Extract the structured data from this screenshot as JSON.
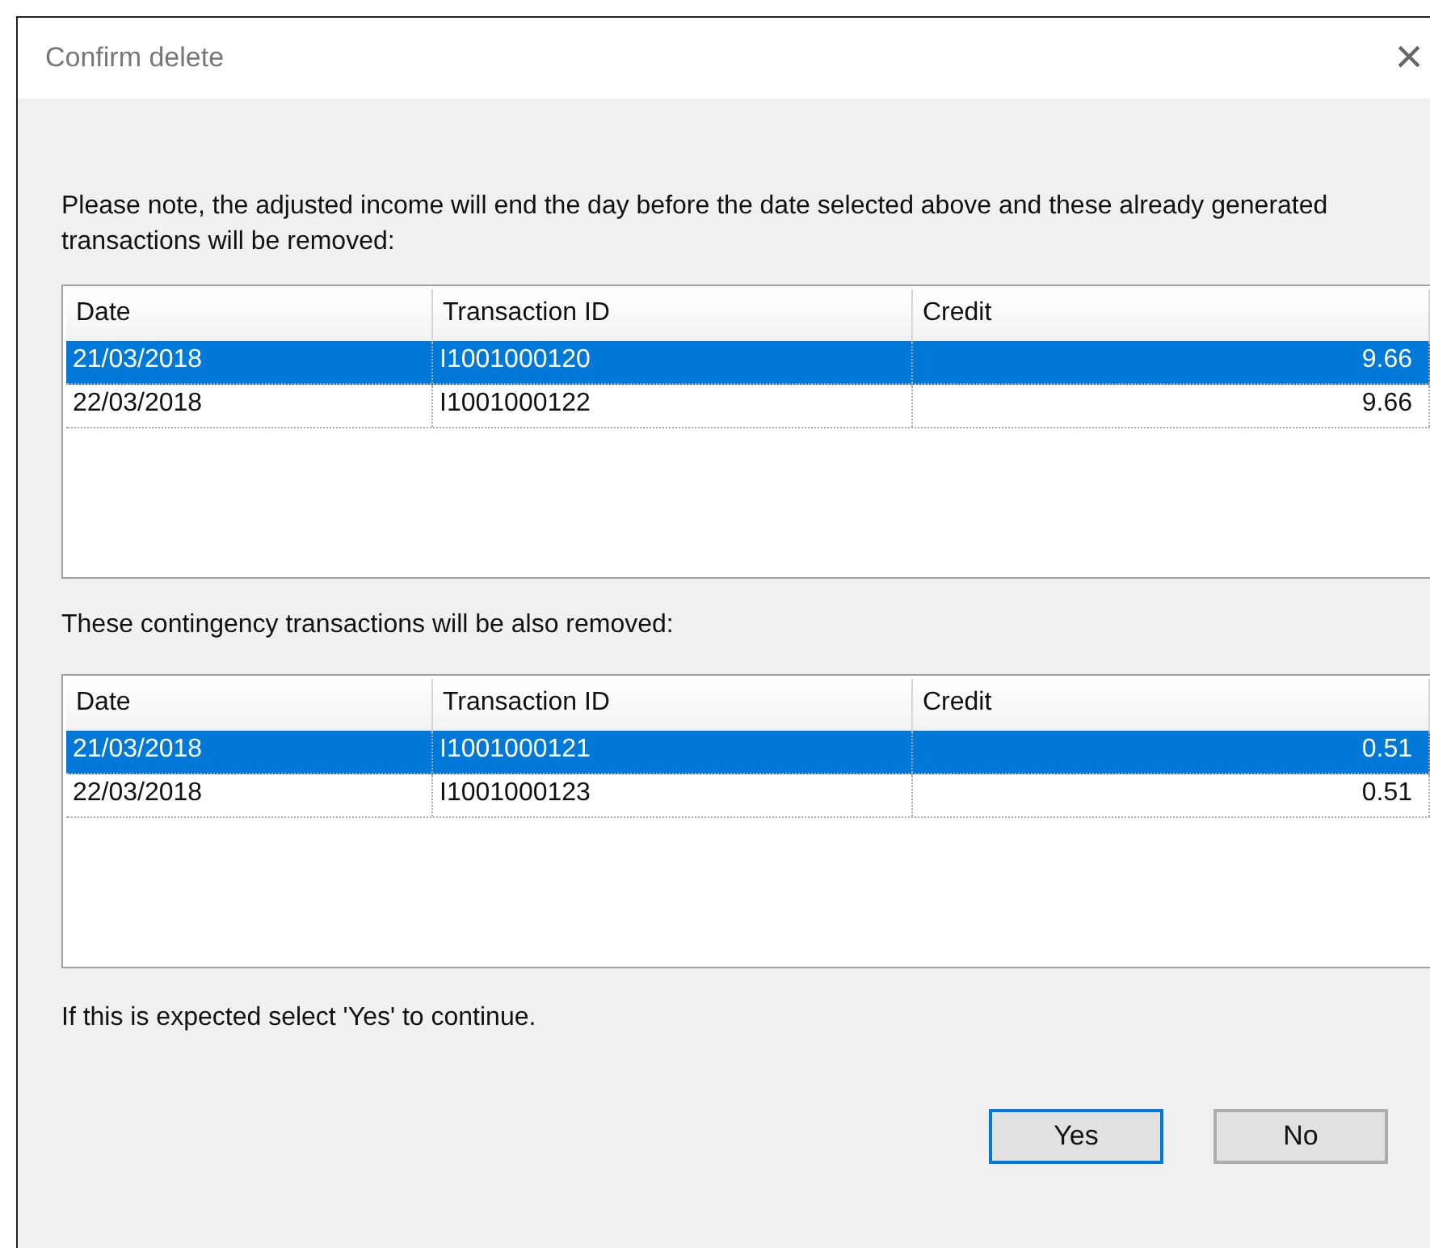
{
  "window": {
    "title": "Confirm delete",
    "close": "×"
  },
  "message": "Please note, the adjusted income will end the day before the date selected above and these already generated transactions will be removed:",
  "lists": [
    {
      "columns": [
        "Date",
        "Transaction ID",
        "Credit"
      ],
      "rows": [
        {
          "date": "21/03/2018",
          "transaction_id": "I1001000120",
          "credit": "9.66",
          "selected": true
        },
        {
          "date": "22/03/2018",
          "transaction_id": "I1001000122",
          "credit": "9.66",
          "selected": false
        }
      ]
    },
    {
      "caption": "These contingency transactions will be also removed:",
      "columns": [
        "Date",
        "Transaction ID",
        "Credit"
      ],
      "rows": [
        {
          "date": "21/03/2018",
          "transaction_id": "I1001000121",
          "credit": "0.51",
          "selected": true
        },
        {
          "date": "22/03/2018",
          "transaction_id": "I1001000123",
          "credit": "0.51",
          "selected": false
        }
      ]
    }
  ],
  "footer": "If this is expected select 'Yes' to continue.",
  "buttons": [
    {
      "label": "Yes",
      "focused": true
    },
    {
      "label": "No",
      "focused": false
    }
  ]
}
